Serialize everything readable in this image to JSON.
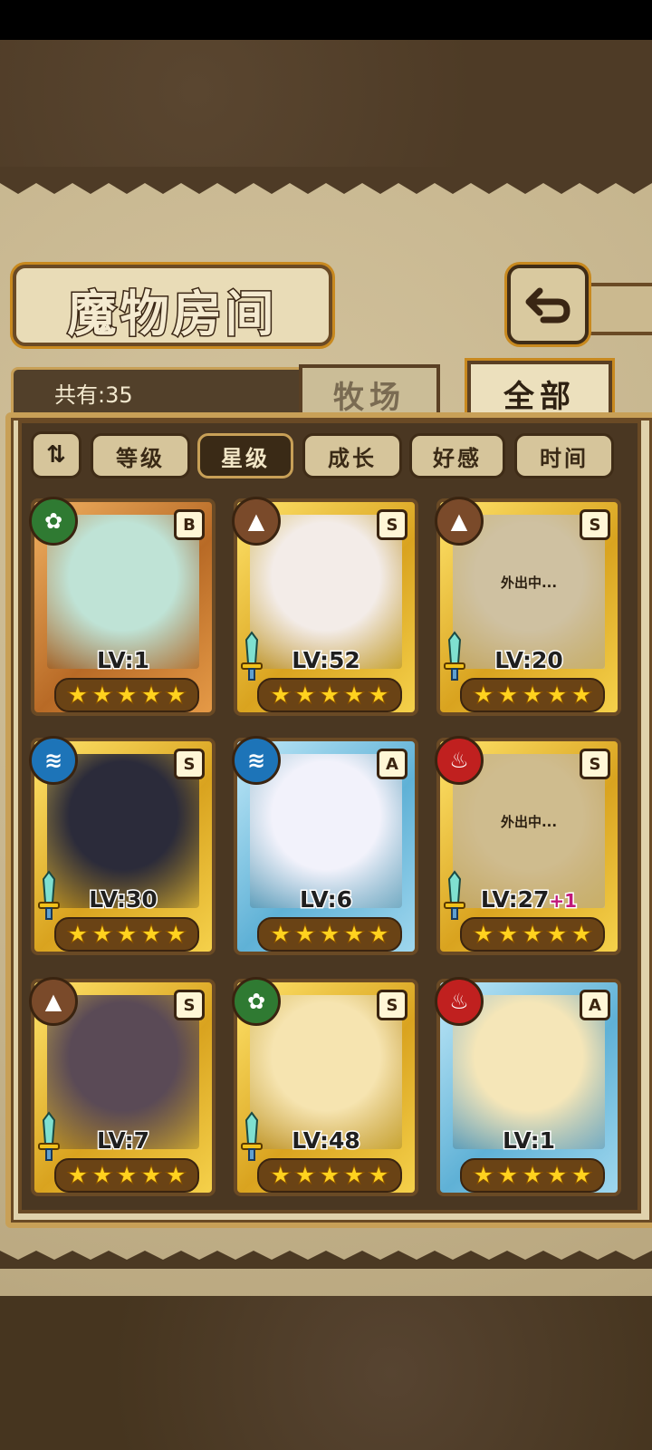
{
  "title": "魔物房间",
  "count_label": "共有:35",
  "tabs": [
    {
      "label": "牧场",
      "active": false
    },
    {
      "label": "全部",
      "active": true
    }
  ],
  "sort_toggle_label": "⇅",
  "sort_buttons": [
    {
      "label": "等级",
      "active": false
    },
    {
      "label": "星级",
      "active": true
    },
    {
      "label": "成长",
      "active": false
    },
    {
      "label": "好感",
      "active": false
    },
    {
      "label": "时间",
      "active": false
    }
  ],
  "monsters": [
    {
      "level_text": "LV:1",
      "bonus": "",
      "rank": "B",
      "element": "leaf-icon",
      "element_glyph": "✿",
      "frame": "bronze",
      "stars": 5,
      "status": ""
    },
    {
      "level_text": "LV:52",
      "bonus": "",
      "rank": "S",
      "element": "earth-icon",
      "element_glyph": "▲",
      "frame": "gold",
      "stars": 5,
      "status": ""
    },
    {
      "level_text": "LV:20",
      "bonus": "",
      "rank": "S",
      "element": "earth-icon",
      "element_glyph": "▲",
      "frame": "gold",
      "stars": 5,
      "status": "外出中..."
    },
    {
      "level_text": "LV:30",
      "bonus": "",
      "rank": "S",
      "element": "water-icon",
      "element_glyph": "≋",
      "frame": "gold",
      "stars": 5,
      "status": ""
    },
    {
      "level_text": "LV:6",
      "bonus": "",
      "rank": "A",
      "element": "water-icon",
      "element_glyph": "≋",
      "frame": "blue",
      "stars": 5,
      "status": ""
    },
    {
      "level_text": "LV:27",
      "bonus": "+1",
      "rank": "S",
      "element": "fire-icon",
      "element_glyph": "♨",
      "frame": "gold",
      "stars": 5,
      "status": "外出中..."
    },
    {
      "level_text": "LV:7",
      "bonus": "",
      "rank": "S",
      "element": "earth-icon",
      "element_glyph": "▲",
      "frame": "gold",
      "stars": 5,
      "status": ""
    },
    {
      "level_text": "LV:48",
      "bonus": "",
      "rank": "S",
      "element": "leaf-icon",
      "element_glyph": "✿",
      "frame": "gold",
      "stars": 5,
      "status": ""
    },
    {
      "level_text": "LV:1",
      "bonus": "",
      "rank": "A",
      "element": "fire-icon",
      "element_glyph": "♨",
      "frame": "blue",
      "stars": 5,
      "status": ""
    }
  ],
  "art_colors": [
    "#bfe3d6",
    "#f3ece8",
    "#d7ccb4",
    "#2b2b3a",
    "#f2f2fb",
    "#d8c08a",
    "#5a4a56",
    "#f6e4b0",
    "#f5e6b8"
  ]
}
